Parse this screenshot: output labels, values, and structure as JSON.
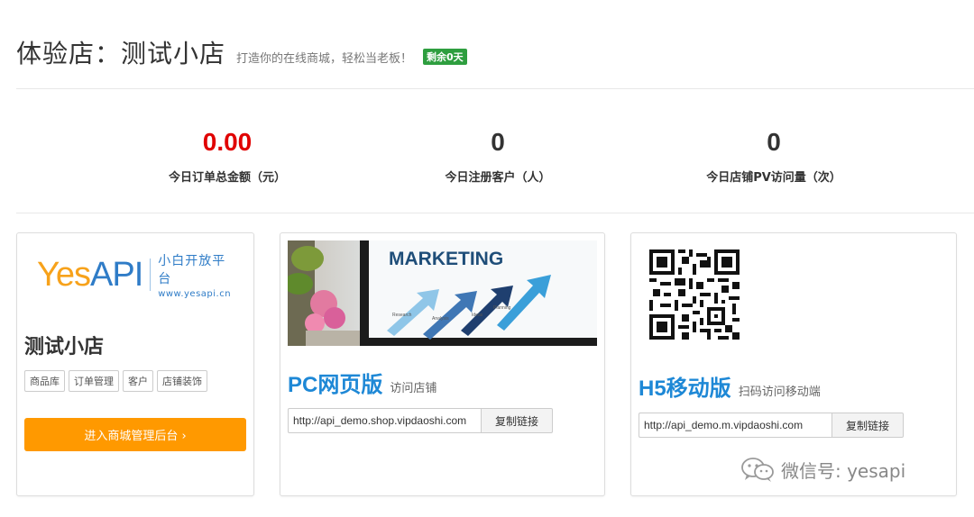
{
  "header": {
    "title": "体验店：测试小店",
    "slogan": "打造你的在线商城，轻松当老板！",
    "badge": "剩余0天"
  },
  "stats": [
    {
      "value": "0.00",
      "label": "今日订单总金额（元）",
      "color": "#e00000"
    },
    {
      "value": "0",
      "label": "今日注册客户（人）"
    },
    {
      "value": "0",
      "label": "今日店铺PV访问量（次）"
    }
  ],
  "store_card": {
    "logo_yes": "Yes",
    "logo_api": "API",
    "logo_cn": "小白开放平台",
    "logo_url": "www.yesapi.cn",
    "name": "测试小店",
    "tags": [
      "商品库",
      "订单管理",
      "客户",
      "店铺装饰"
    ],
    "enter_button": "进入商城管理后台 ›",
    "button_color": "#ff9900"
  },
  "pc_card": {
    "banner_text": "MARKETING",
    "banner_steps": [
      "Research",
      "Analysis",
      "Ideas",
      "Planning"
    ],
    "title": "PC网页版",
    "subtitle": "访问店铺",
    "link": "http://api_demo.shop.vipdaoshi.com",
    "copy_button": "复制链接"
  },
  "h5_card": {
    "qr_icon": "qr-code-icon",
    "title": "H5移动版",
    "subtitle": "扫码访问移动端",
    "link": "http://api_demo.m.vipdaoshi.com",
    "copy_button": "复制链接"
  },
  "watermark": {
    "icon": "wechat-icon",
    "text": "微信号: yesapi"
  },
  "colors": {
    "accent_blue": "#1e88d6",
    "badge_green": "#2e9e3f",
    "amount_red": "#e00000"
  }
}
